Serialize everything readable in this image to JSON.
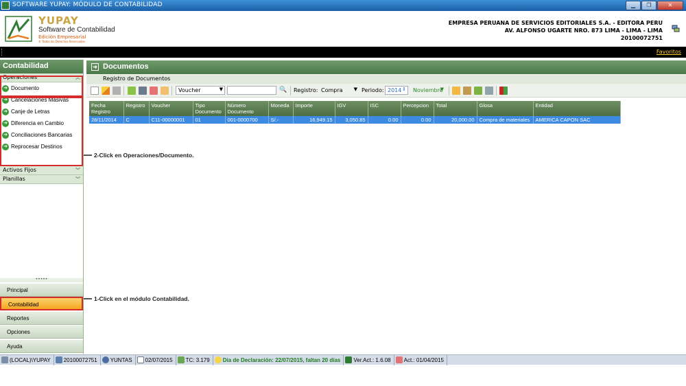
{
  "window": {
    "title": "SOFTWARE YUPAY: MÓDULO DE CONTABILIDAD"
  },
  "brand": {
    "name": "YUPAY",
    "subtitle": "Software de Contabilidad",
    "edition": "Edición Empresarial",
    "tagline": "© Todos los Derechos Reservados"
  },
  "company": {
    "name": "EMPRESA PERUANA DE SERVICIOS EDITORIALES S.A. - EDITORA PERU",
    "address": "AV. ALFONSO UGARTE NRO. 873 LIMA - LIMA - LIMA",
    "ruc": "20100072751"
  },
  "favorites": {
    "label": "Favoritos"
  },
  "left": {
    "title": "Contabilidad",
    "operaciones": "Operaciones",
    "items": [
      "Documento",
      "Cancelaciones Masivas",
      "Canje de Letras",
      "Diferencia en Cambio",
      "Conciliaciones Bancarias",
      "Reprocesar Destinos"
    ],
    "sections": [
      "Activos Fijos",
      "Planillas"
    ],
    "modules": [
      "Principal",
      "Contabilidad",
      "Reportes",
      "Opciones",
      "Ayuda"
    ]
  },
  "main": {
    "title": "Documentos",
    "subtitle": "Registro de Documentos",
    "toolbar": {
      "voucher_value": "Voucher",
      "search_value": "",
      "registro_label": "Registro:",
      "registro_value": "Compra",
      "periodo_label": "Periodo:",
      "year_value": "2014",
      "month_value": "Noviembre"
    },
    "columns": [
      "Fecha Registro",
      "Registro",
      "Voucher",
      "Tipo Documento",
      "Número Documento",
      "Moneda",
      "Importe",
      "IGV",
      "ISC",
      "Percepcion",
      "Total",
      "Glosa",
      "Entidad"
    ],
    "rows": [
      [
        "28/11/2014",
        "C",
        "C11-00000001",
        "01",
        "001-0000700",
        "S/.-",
        "16,949.15",
        "3,050.85",
        "0.00",
        "0.00",
        "20,000.00",
        "Compra de materiales",
        "AMERICA CAPON SAC"
      ]
    ]
  },
  "annotations": {
    "step2": "2-Click en Operaciones/Documento.",
    "step1": "1-Click en el módulo Contabilidad."
  },
  "status": {
    "server": "(LOCAL)\\YUPAY",
    "ruc": "20100072751",
    "user": "YUNTAS",
    "date": "02/07/2015",
    "tc": "TC: 3.179",
    "declaracion": "Día de Declaración: 22/07/2015, faltan 20 días",
    "version": "Ver.Act.: 1.6.08",
    "act": "Act.: 01/04/2015"
  },
  "colors": {
    "accent_green": "#4c7a49",
    "selection_blue": "#3d8be0",
    "highlight_red": "#d42b2b",
    "active_module": "#f5a623"
  }
}
